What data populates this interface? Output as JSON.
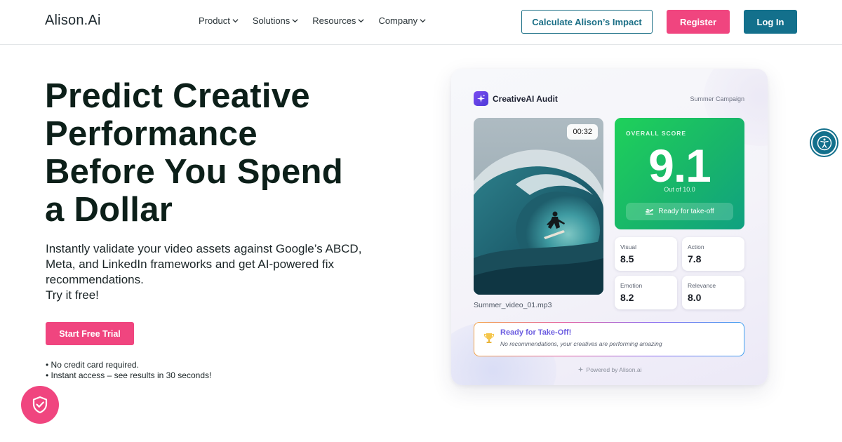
{
  "header": {
    "logo": "Alison.Ai",
    "nav": [
      {
        "label": "Product"
      },
      {
        "label": "Solutions"
      },
      {
        "label": "Resources"
      },
      {
        "label": "Company"
      }
    ],
    "impact_label": "Calculate Alison’s Impact",
    "register_label": "Register",
    "login_label": "Log In"
  },
  "hero": {
    "title_lines": [
      "Predict Creative",
      "Performance",
      "Before You Spend",
      "a Dollar"
    ],
    "subtitle_lines": [
      "Instantly validate your video assets against Google’s ABCD,",
      "Meta, and LinkedIn frameworks and get AI-powered fix",
      "recommendations.",
      "Try it free!"
    ],
    "cta_label": "Start Free Trial",
    "bullets": [
      "• No credit card required.",
      "• Instant access – see results in 30 seconds!"
    ]
  },
  "card": {
    "title": "CreativeAI Audit",
    "campaign": "Summer Campaign",
    "video_duration": "00:32",
    "video_filename": "Summer_video_01.mp3",
    "score": {
      "label": "OVERALL SCORE",
      "value": "9.1",
      "out_of": "Out of 10.0",
      "status": "Ready for take-off"
    },
    "metrics": [
      {
        "label": "Visual",
        "value": "8.5"
      },
      {
        "label": "Action",
        "value": "7.8"
      },
      {
        "label": "Emotion",
        "value": "8.2"
      },
      {
        "label": "Relevance",
        "value": "8.0"
      }
    ],
    "takeoff": {
      "title": "Ready for Take-Off!",
      "description": "No recommendations, your creatives are performing amazing"
    },
    "powered_by": "Powered by Alison.ai"
  },
  "colors": {
    "brand_pink": "#f0457f",
    "brand_teal": "#13708c",
    "score_green": "#1fd15a",
    "accent_purple": "#6b5ce0"
  },
  "icons": [
    "chevron-down-icon",
    "sparkle-icon",
    "plane-icon",
    "trophy-icon",
    "shield-check-icon",
    "accessibility-icon"
  ]
}
